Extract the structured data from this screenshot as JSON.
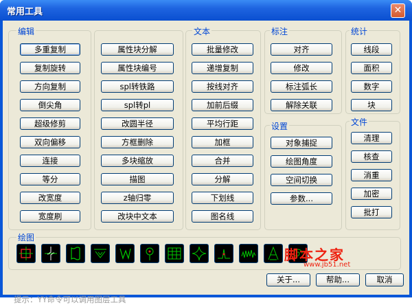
{
  "window": {
    "title": "常用工具",
    "close_glyph": "✕"
  },
  "groups": {
    "edit": "编辑",
    "text": "文本",
    "annotate": "标注",
    "stats": "统计",
    "settings": "设置",
    "file": "文件",
    "draw": "绘图"
  },
  "edit_col1": [
    "多重复制",
    "复制旋转",
    "方向复制",
    "倒尖角",
    "超级修剪",
    "双向偏移",
    "连接",
    "等分",
    "改宽度",
    "宽度刷"
  ],
  "edit_col2": [
    "属性块分解",
    "属性块编号",
    "spl转铁路",
    "spl转pl",
    "改圆半径",
    "方框删除",
    "多块缩放",
    "描图",
    "z轴归零",
    "改块中文本"
  ],
  "text_col": [
    "批量修改",
    "递增复制",
    "按线对齐",
    "加前后缀",
    "平均行距",
    "加框",
    "合并",
    "分解",
    "下划线",
    "图名线"
  ],
  "annotate_col": [
    "对齐",
    "修改",
    "标注弧长",
    "解除关联"
  ],
  "settings_col": [
    "对象捕捉",
    "绘图角度",
    "空间切换",
    "参数..."
  ],
  "stats_col": [
    "线段",
    "面积",
    "数字",
    "块"
  ],
  "file_col": [
    "清理",
    "核查",
    "消重",
    "加密",
    "批打"
  ],
  "draw_icons": [
    "crosshair-box-icon",
    "zigzag-line-icon",
    "wavy-outline-icon",
    "hatch-down-icon",
    "pen-strokes-icon",
    "circle-pin-icon",
    "grid-table-icon",
    "star-curve-icon",
    "signal-line-icon",
    "waveform-icon",
    "tower-icon",
    "spiral-icon"
  ],
  "footer": {
    "hint": "提示：YY命令可以调用图层工具",
    "about": "关于...",
    "help": "帮助...",
    "cancel": "取消"
  },
  "watermark": {
    "main": "脚本之家",
    "url": "www.jb51.net"
  }
}
